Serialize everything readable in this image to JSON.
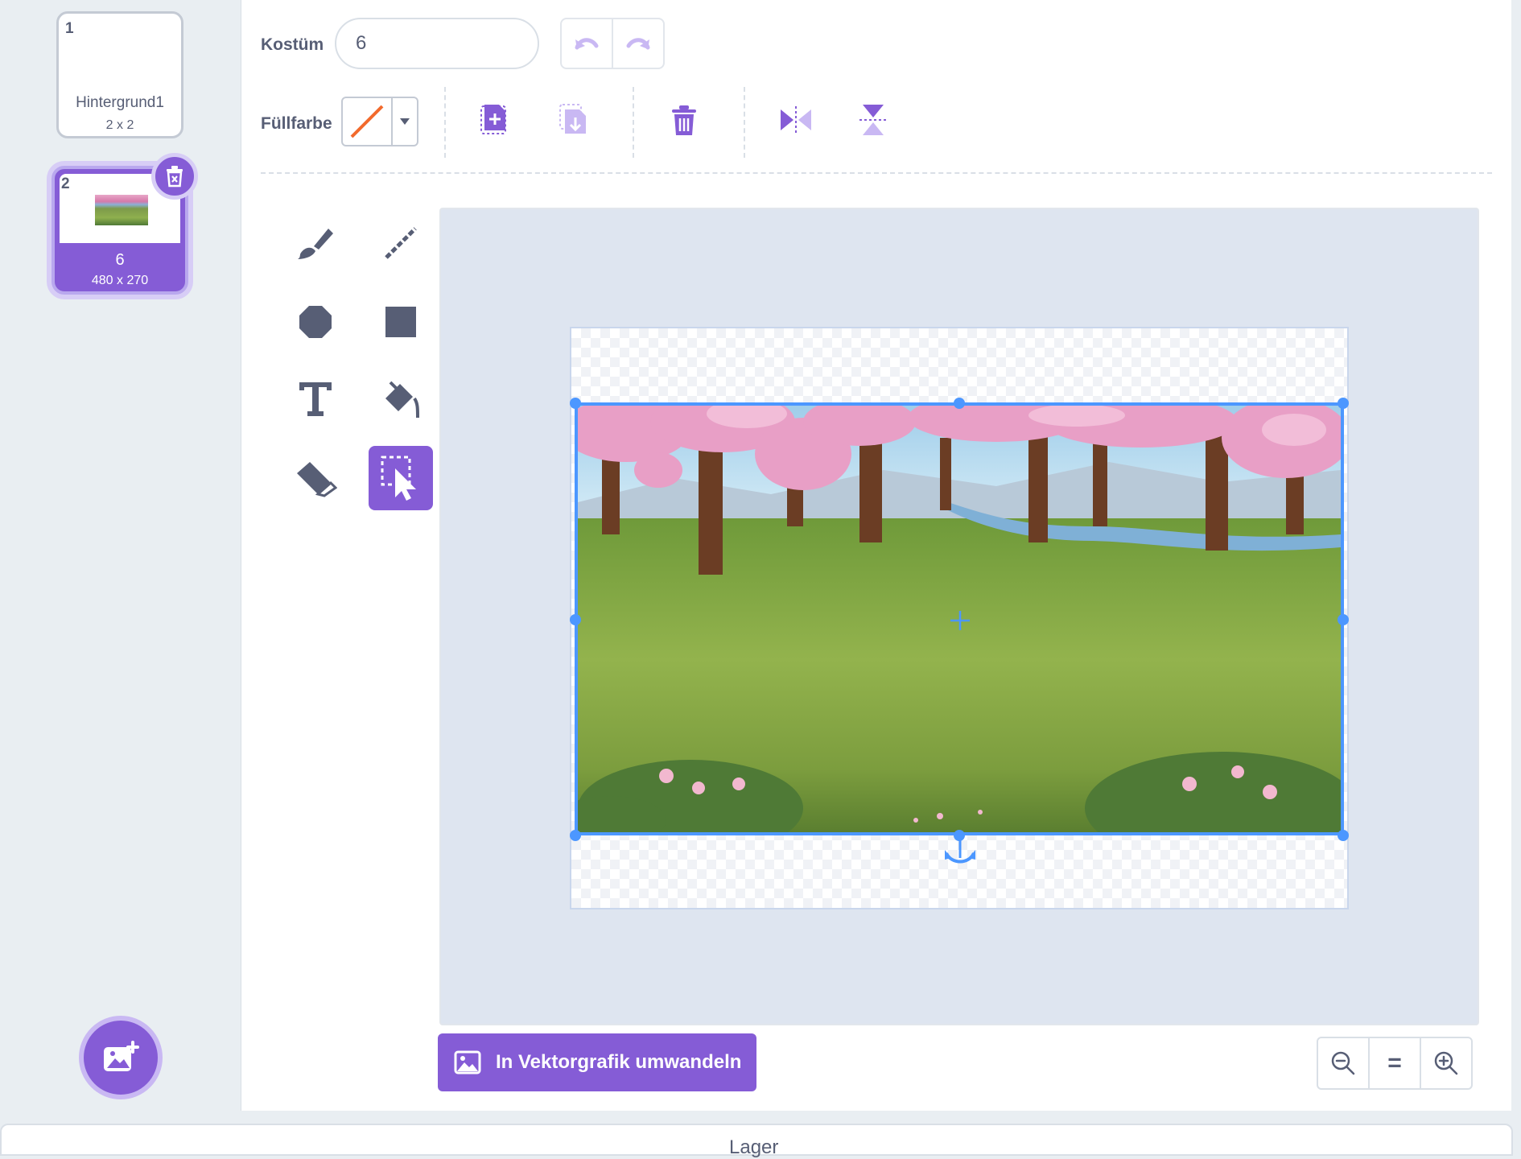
{
  "costumes": [
    {
      "number": "1",
      "name": "Hintergrund1",
      "size": "2 x 2"
    },
    {
      "number": "2",
      "name": "6",
      "size": "480 x 270"
    }
  ],
  "toolbar": {
    "costume_label": "Kostüm",
    "costume_name": "6",
    "fill_label": "Füllfarbe"
  },
  "icons": {
    "undo": "undo-icon",
    "redo": "redo-icon",
    "copy": "copy-icon",
    "paste": "paste-icon",
    "delete": "trash-icon",
    "flip_h": "flip-horizontal-icon",
    "flip_v": "flip-vertical-icon"
  },
  "tools": [
    "brush",
    "line",
    "circle",
    "rectangle",
    "text",
    "fill",
    "eraser",
    "select"
  ],
  "active_tool": "select",
  "convert_button": "In Vektorgrafik umwandeln",
  "zoom": {
    "out": "zoom-out-icon",
    "reset": "=",
    "in": "zoom-in-icon"
  },
  "bottom_tab": "Lager",
  "colors": {
    "accent": "#855cd6",
    "selection": "#4c97ff",
    "text": "#575e75"
  }
}
